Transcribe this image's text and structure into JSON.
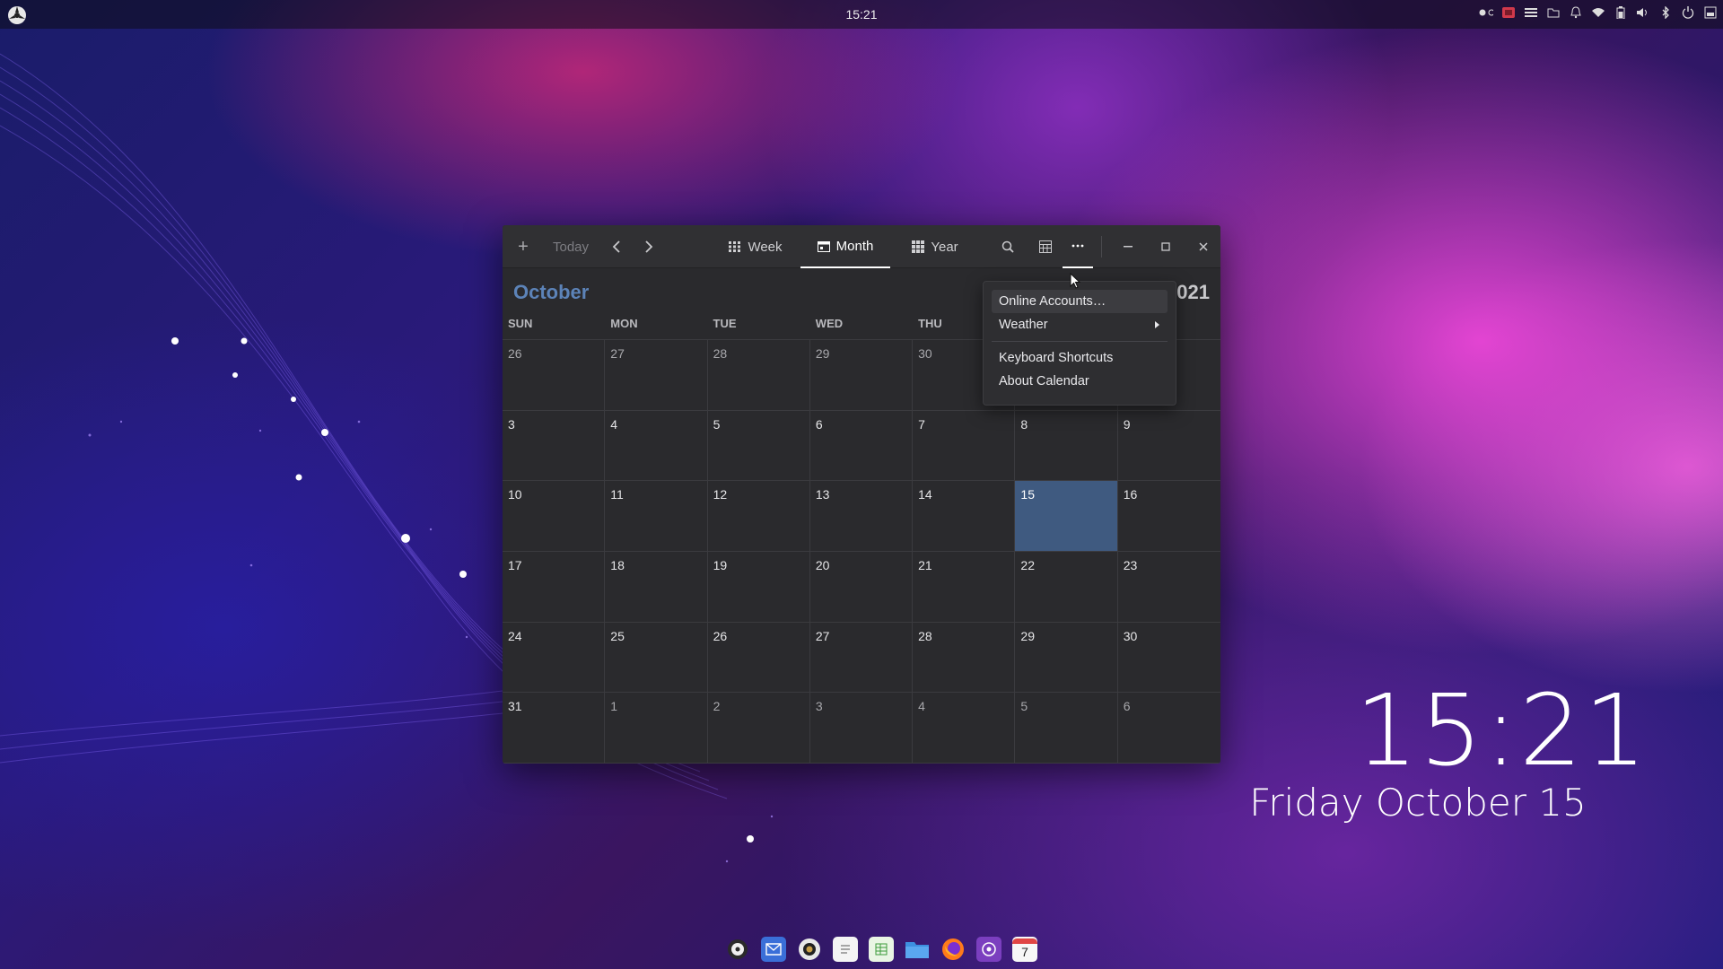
{
  "top_bar": {
    "clock": "15:21",
    "tray_icons": [
      "record-indicator-icon",
      "screenshot-app-icon",
      "menu-icon",
      "files-icon",
      "notifications-icon",
      "network-icon",
      "battery-icon",
      "volume-icon",
      "bluetooth-icon",
      "power-icon",
      "display-icon"
    ]
  },
  "desktop_clock": {
    "time": "15:21",
    "date": "Friday October 15"
  },
  "calendar_window": {
    "header": {
      "add_label": "+",
      "today_label": "Today",
      "views": [
        {
          "label": "Week",
          "active": false
        },
        {
          "label": "Month",
          "active": true
        },
        {
          "label": "Year",
          "active": false
        }
      ]
    },
    "month_title": "October",
    "year_title": "021",
    "weekdays": [
      "SUN",
      "MON",
      "TUE",
      "WED",
      "THU",
      "",
      ""
    ],
    "weeks": [
      [
        "26",
        "27",
        "28",
        "29",
        "30",
        "",
        ""
      ],
      [
        "3",
        "4",
        "5",
        "6",
        "7",
        "8",
        "9"
      ],
      [
        "10",
        "11",
        "12",
        "13",
        "14",
        "15",
        "16"
      ],
      [
        "17",
        "18",
        "19",
        "20",
        "21",
        "22",
        "23"
      ],
      [
        "24",
        "25",
        "26",
        "27",
        "28",
        "29",
        "30"
      ],
      [
        "31",
        "1",
        "2",
        "3",
        "4",
        "5",
        "6"
      ]
    ],
    "today": "15",
    "accent_color": "#5c83b8",
    "today_color": "#3f5a80"
  },
  "menu": {
    "items": [
      {
        "label": "Online Accounts…"
      },
      {
        "label": "Weather"
      },
      {
        "label": "Keyboard Shortcuts"
      },
      {
        "label": "About Calendar"
      }
    ]
  },
  "dock": {
    "apps": [
      "launcher-icon",
      "mail-icon",
      "camera-icon",
      "text-editor-icon",
      "spreadsheet-icon",
      "files-icon",
      "firefox-icon",
      "media-icon",
      "calendar-icon"
    ],
    "calendar_day": "7"
  }
}
